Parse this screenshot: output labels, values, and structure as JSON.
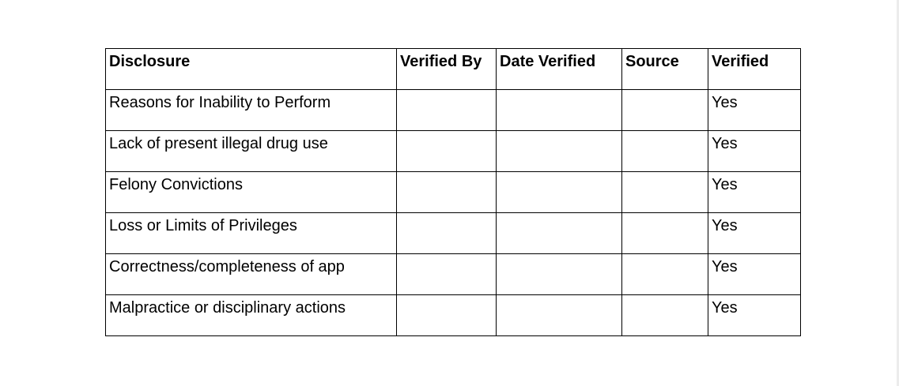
{
  "table": {
    "headers": [
      "Disclosure",
      "Verified By",
      "Date Verified",
      "Source",
      "Verified"
    ],
    "rows": [
      {
        "disclosure": "Reasons for Inability to Perform",
        "verified_by": "",
        "date_verified": "",
        "source": "",
        "verified": "Yes"
      },
      {
        "disclosure": "Lack of present illegal drug use",
        "verified_by": "",
        "date_verified": "",
        "source": "",
        "verified": "Yes"
      },
      {
        "disclosure": "Felony Convictions",
        "verified_by": "",
        "date_verified": "",
        "source": "",
        "verified": "Yes"
      },
      {
        "disclosure": "Loss or Limits of Privileges",
        "verified_by": "",
        "date_verified": "",
        "source": "",
        "verified": "Yes"
      },
      {
        "disclosure": "Correctness/completeness of app",
        "verified_by": "",
        "date_verified": "",
        "source": "",
        "verified": "Yes"
      },
      {
        "disclosure": "Malpractice or disciplinary actions",
        "verified_by": "",
        "date_verified": "",
        "source": "",
        "verified": "Yes"
      }
    ]
  }
}
